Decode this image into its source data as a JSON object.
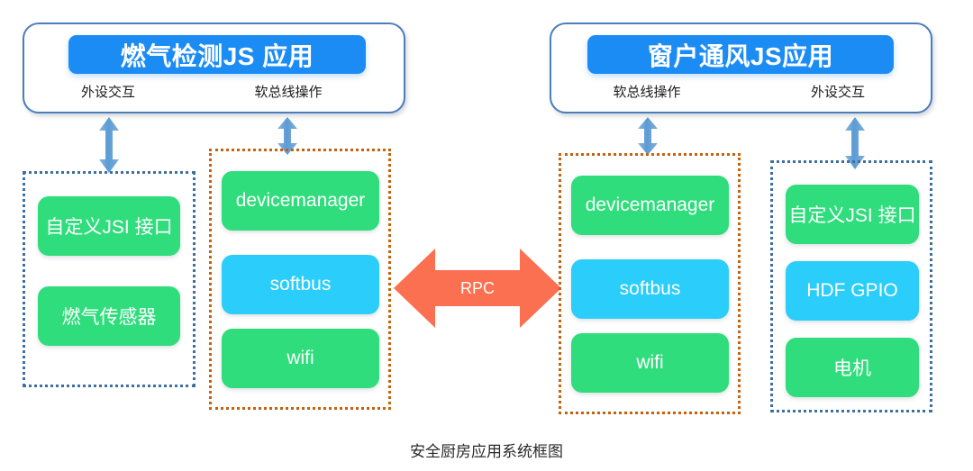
{
  "diagram": {
    "caption": "安全厨房应用系统框图",
    "colors": {
      "app_title_blue": "#1c8cf5",
      "panel_border_blue": "#4a7ebb",
      "module_green": "#2fdd7c",
      "module_cyan": "#2bcdfb",
      "dotted_blue": "#3f6f9f",
      "dotted_orange": "#c6610d",
      "rpc_orange": "#fb7051",
      "arrow_blue": "#5b9bd5"
    },
    "apps": [
      {
        "title": "燃气检测JS 应用",
        "sublabels": [
          {
            "text": "外设交互"
          },
          {
            "text": "软总线操作"
          }
        ]
      },
      {
        "title": "窗户通风JS应用",
        "sublabels": [
          {
            "text": "软总线操作"
          },
          {
            "text": "外设交互"
          }
        ]
      }
    ],
    "columns": [
      {
        "id": "left-device-column",
        "border": "dotted-blue",
        "modules": [
          {
            "label": "自定义JSI 接口",
            "color": "green"
          },
          {
            "label": "燃气传感器",
            "color": "green"
          }
        ]
      },
      {
        "id": "left-softbus-column",
        "border": "dotted-orange",
        "modules": [
          {
            "label": "devicemanager",
            "color": "green"
          },
          {
            "label": "softbus",
            "color": "cyan"
          },
          {
            "label": "wifi",
            "color": "green"
          }
        ]
      },
      {
        "id": "right-softbus-column",
        "border": "dotted-orange",
        "modules": [
          {
            "label": "devicemanager",
            "color": "green"
          },
          {
            "label": "softbus",
            "color": "cyan"
          },
          {
            "label": "wifi",
            "color": "green"
          }
        ]
      },
      {
        "id": "right-device-column",
        "border": "dotted-blue",
        "modules": [
          {
            "label": "自定义JSI 接口",
            "color": "green"
          },
          {
            "label": "HDF GPIO",
            "color": "cyan"
          },
          {
            "label": "电机",
            "color": "green"
          }
        ]
      }
    ],
    "rpc": {
      "label": "RPC"
    }
  }
}
